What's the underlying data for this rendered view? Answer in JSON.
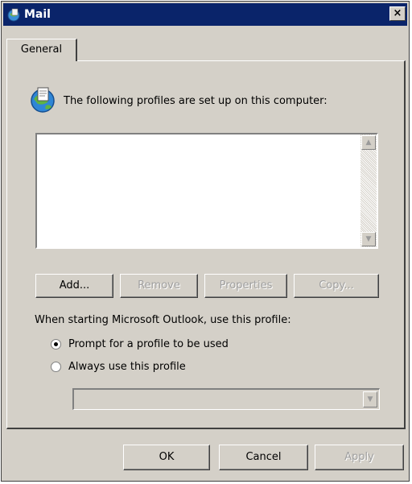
{
  "window": {
    "title": "Mail",
    "close_glyph": "×",
    "icon": "mail-app-icon"
  },
  "tabs": [
    {
      "label": "General",
      "selected": true
    }
  ],
  "profiles": {
    "heading": "The following profiles are set up on this computer:",
    "icon": "profiles-globe-icon",
    "items": []
  },
  "scrollbar": {
    "up_glyph": "▲",
    "down_glyph": "▼"
  },
  "buttons": {
    "add": "Add...",
    "remove": "Remove",
    "properties": "Properties",
    "copy": "Copy..."
  },
  "startup": {
    "label": "When starting Microsoft Outlook, use this profile:",
    "options": [
      {
        "label": "Prompt for a profile to be used",
        "selected": true
      },
      {
        "label": "Always use this profile",
        "selected": false
      }
    ],
    "profile_select_value": "",
    "dropdown_glyph": "▼"
  },
  "footer": {
    "ok": "OK",
    "cancel": "Cancel",
    "apply": "Apply"
  },
  "colors": {
    "titlebar": "#0a246a",
    "dialog_face": "#d4d0c8",
    "disabled_text": "#a0a0a0"
  }
}
